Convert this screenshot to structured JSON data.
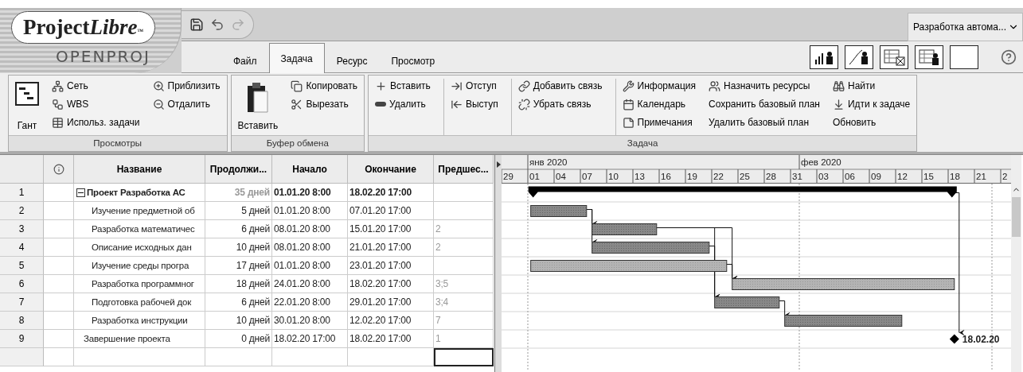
{
  "logo": {
    "name": "Project",
    "name_emphasis": "Libre",
    "trademark": "™",
    "subtitle": "OPENPROJ"
  },
  "project_selector": {
    "value": "Разработка автома..."
  },
  "tabs": [
    {
      "label": "Файл",
      "selected": false
    },
    {
      "label": "Задача",
      "selected": true
    },
    {
      "label": "Ресурс",
      "selected": false
    },
    {
      "label": "Просмотр",
      "selected": false
    }
  ],
  "ribbon": [
    {
      "title": "Просмотры",
      "sections": [
        {
          "kind": "large",
          "items": [
            {
              "label": "Гант"
            }
          ]
        },
        {
          "kind": "list",
          "items": [
            {
              "label": "Сеть"
            },
            {
              "label": "WBS"
            },
            {
              "label": "Использ. задачи"
            }
          ]
        },
        {
          "kind": "list",
          "items": [
            {
              "label": "Приблизить"
            },
            {
              "label": "Отдалить"
            }
          ]
        }
      ]
    },
    {
      "title": "Буфер обмена",
      "sections": [
        {
          "kind": "large",
          "items": [
            {
              "label": "Вставить"
            }
          ]
        },
        {
          "kind": "list",
          "items": [
            {
              "label": "Копировать"
            },
            {
              "label": "Вырезать"
            }
          ]
        }
      ]
    },
    {
      "title": "Задача",
      "sections": [
        {
          "kind": "list",
          "items": [
            {
              "label": "Вставить"
            },
            {
              "label": "Удалить"
            }
          ]
        },
        {
          "kind": "list",
          "separator_before": true,
          "items": [
            {
              "label": "Отступ"
            },
            {
              "label": "Выступ"
            }
          ]
        },
        {
          "kind": "list",
          "separator_before": true,
          "items": [
            {
              "label": "Добавить связь"
            },
            {
              "label": "Убрать связь"
            }
          ]
        },
        {
          "kind": "list",
          "separator_before": true,
          "items": [
            {
              "label": "Информация"
            },
            {
              "label": "Календарь"
            },
            {
              "label": "Примечания"
            }
          ]
        },
        {
          "kind": "list",
          "items": [
            {
              "label": "Назначить ресурсы"
            },
            {
              "label": "Сохранить базовый план"
            },
            {
              "label": "Удалить базовый план"
            }
          ]
        },
        {
          "kind": "list",
          "items": [
            {
              "label": "Найти"
            },
            {
              "label": "Идти к задаче"
            },
            {
              "label": "Обновить"
            }
          ]
        }
      ]
    }
  ],
  "table": {
    "columns": [
      "Название",
      "Продолжи...",
      "Начало",
      "Окончание",
      "Предшес..."
    ],
    "rows": [
      {
        "id": "1",
        "kind": "summary",
        "expanded": true,
        "name": "Проект Разработка АС",
        "duration": "35 дней",
        "start": "01.01.20 8:00",
        "finish": "18.02.20 17:00",
        "children": [
          {
            "id": "2",
            "kind": "task",
            "critical": true,
            "name": "Изучение предметной об",
            "duration": "5 дней",
            "start": "01.01.20 8:00",
            "finish": "07.01.20 17:00"
          },
          {
            "id": "3",
            "kind": "task",
            "critical": true,
            "name": "Разработка математичес",
            "duration": "6 дней",
            "start": "08.01.20 8:00",
            "finish": "15.01.20 17:00",
            "predecessors": "2"
          },
          {
            "id": "4",
            "kind": "task",
            "critical": true,
            "name": "Описание исходных дан",
            "duration": "10 дней",
            "start": "08.01.20 8:00",
            "finish": "21.01.20 17:00",
            "predecessors": "2"
          },
          {
            "id": "5",
            "kind": "task",
            "critical": false,
            "name": "Изучение среды програ",
            "duration": "17 дней",
            "start": "01.01.20 8:00",
            "finish": "23.01.20 17:00"
          },
          {
            "id": "6",
            "kind": "task",
            "critical": false,
            "name": "Разработка программног",
            "duration": "18 дней",
            "start": "24.01.20 8:00",
            "finish": "18.02.20 17:00",
            "predecessors": "3;5"
          },
          {
            "id": "7",
            "kind": "task",
            "critical": true,
            "name": "Подготовка рабочей док",
            "duration": "6 дней",
            "start": "22.01.20 8:00",
            "finish": "29.01.20 17:00",
            "predecessors": "3;4"
          },
          {
            "id": "8",
            "kind": "task",
            "critical": true,
            "name": "Разработка инструкции",
            "duration": "10 дней",
            "start": "30.01.20 8:00",
            "finish": "12.02.20 17:00",
            "predecessors": "7"
          }
        ]
      },
      {
        "id": "9",
        "kind": "milestone",
        "name": "Завершение проекта",
        "duration": "0 дней",
        "start": "18.02.20 17:00",
        "finish": "18.02.20 17:00",
        "predecessors": "1",
        "bar_label": "18.02.20"
      }
    ],
    "empty_row": {
      "predecessors_selected": true
    }
  },
  "gantt": {
    "months": [
      "янв 2020",
      "фев 2020"
    ],
    "days": [
      "29",
      "01",
      "04",
      "07",
      "10",
      "13",
      "16",
      "19",
      "22",
      "25",
      "28",
      "31",
      "03",
      "06",
      "09",
      "12",
      "15",
      "18",
      "21",
      "2"
    ]
  }
}
